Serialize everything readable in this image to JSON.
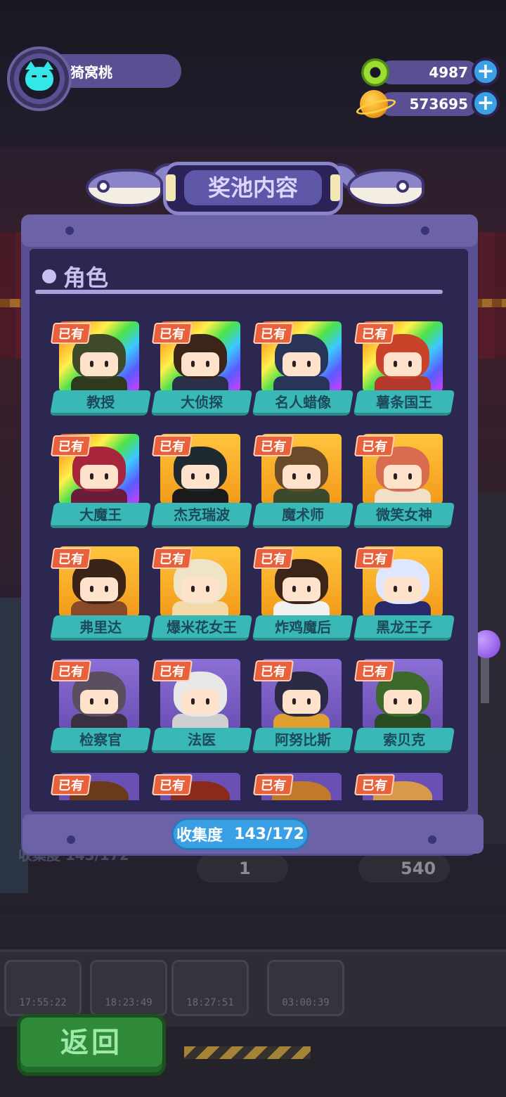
{
  "player": {
    "name": "猗窝桃"
  },
  "currency": {
    "gems": "4987",
    "coins": "573695",
    "gems_icon": "donut-icon",
    "coins_icon": "planet-coin-icon"
  },
  "panel": {
    "title": "奖池内容",
    "section_title": "角色",
    "collection_label": "收集度",
    "collection_value": "143/172"
  },
  "owned_label": "已有",
  "characters": [
    {
      "name": "教授",
      "frame": "rainbow"
    },
    {
      "name": "大侦探",
      "frame": "rainbow"
    },
    {
      "name": "名人蜡像",
      "frame": "rainbow"
    },
    {
      "name": "薯条国王",
      "frame": "rainbow"
    },
    {
      "name": "大魔王",
      "frame": "rainbow"
    },
    {
      "name": "杰克瑞波",
      "frame": "gold"
    },
    {
      "name": "魔术师",
      "frame": "gold"
    },
    {
      "name": "微笑女神",
      "frame": "gold"
    },
    {
      "name": "弗里达",
      "frame": "gold"
    },
    {
      "name": "爆米花女王",
      "frame": "gold"
    },
    {
      "name": "炸鸡魔后",
      "frame": "gold"
    },
    {
      "name": "黑龙王子",
      "frame": "gold"
    },
    {
      "name": "检察官",
      "frame": "purple"
    },
    {
      "name": "法医",
      "frame": "purple"
    },
    {
      "name": "阿努比斯",
      "frame": "purple"
    },
    {
      "name": "索贝克",
      "frame": "purple"
    }
  ],
  "background": {
    "hint_left": "收集度 143/172",
    "coin_row_1": "1",
    "coin_row_2": "540",
    "clocks": [
      "17:55:22",
      "18:23:49",
      "18:27:51",
      "03:00:39"
    ]
  },
  "back_button": "返回"
}
